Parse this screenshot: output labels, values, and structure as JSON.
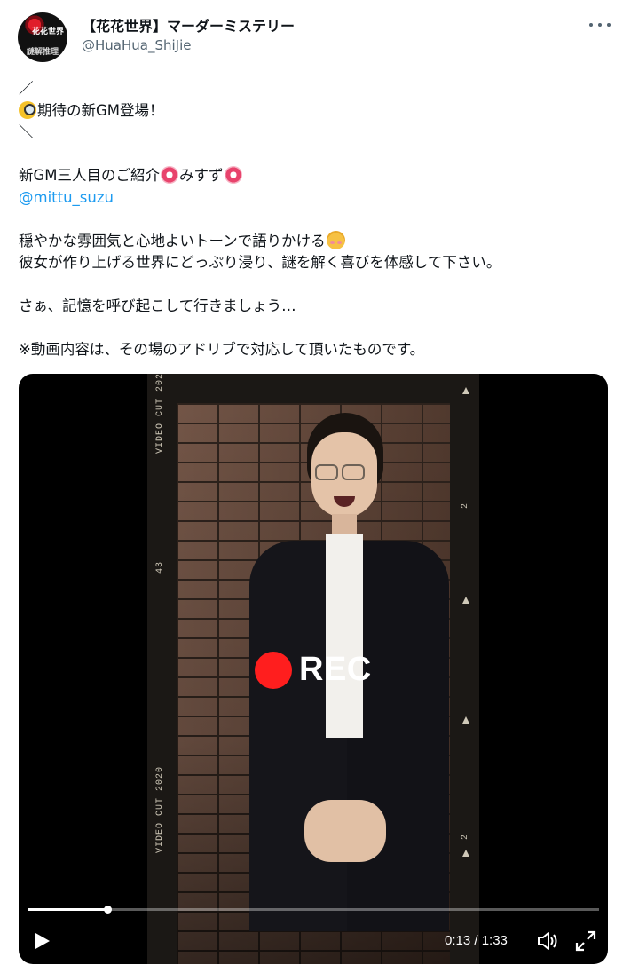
{
  "header": {
    "display_name": "【花花世界】マーダーミステリー",
    "handle": "@HuaHua_ShiJie",
    "avatar_text_top": "花花世界",
    "avatar_text_bottom": "謎解推理"
  },
  "tweet": {
    "line1": "／",
    "line2_text": "期待の新GM登場！",
    "line3": "＼",
    "line4_a": "新GM三人目のご紹介",
    "line4_b": "みすず",
    "mention": "@mittu_suzu",
    "line6": "穏やかな雰囲気と心地よいトーンで語りかける",
    "line7": "彼女が作り上げる世界にどっぷり浸り、謎を解く喜びを体感して下さい。",
    "line8": "さぁ、記憶を呼び起こして行きましょう…",
    "line9": "※動画内容は、その場のアドリブで対応して頂いたものです。",
    "emojis": [
      "magnifying-glass",
      "cherry-blossom",
      "cherry-blossom",
      "smiling-face"
    ]
  },
  "video": {
    "rec_label": "REC",
    "film_label": "VIDEO CUT 2020",
    "film_number_left": "43",
    "film_number_right": "2",
    "current_time": "0:13",
    "duration": "1:33",
    "time_display": "0:13 / 1:33",
    "progress_fraction": 0.14,
    "controls": [
      "play-icon",
      "volume-icon",
      "fullscreen-icon"
    ]
  },
  "colors": {
    "link": "#1d9bf0",
    "secondary_text": "#536471",
    "text": "#0f1419",
    "rec": "#ff1e1e"
  }
}
